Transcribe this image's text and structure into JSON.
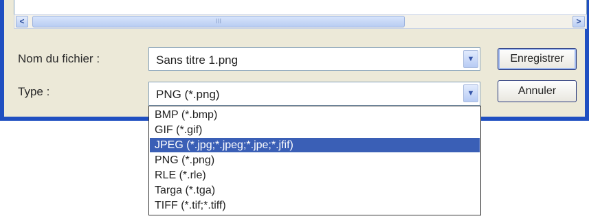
{
  "file_pane": {
    "scroll_thumb_grip": "III",
    "scroll_left_glyph": "<",
    "scroll_right_glyph": ">"
  },
  "form": {
    "filename_label": "Nom du fichier :",
    "filename_value": "Sans titre 1.png",
    "type_label": "Type :",
    "type_value": "PNG (*.png)",
    "dropdown_glyph": "▼"
  },
  "buttons": {
    "save": "Enregistrer",
    "cancel": "Annuler"
  },
  "type_options": [
    {
      "label": "BMP (*.bmp)",
      "selected": false
    },
    {
      "label": "GIF (*.gif)",
      "selected": false
    },
    {
      "label": "JPEG (*.jpg;*.jpeg;*.jpe;*.jfif)",
      "selected": true
    },
    {
      "label": "PNG (*.png)",
      "selected": false
    },
    {
      "label": "RLE (*.rle)",
      "selected": false
    },
    {
      "label": "Targa (*.tga)",
      "selected": false
    },
    {
      "label": "TIFF (*.tif;*.tiff)",
      "selected": false
    }
  ],
  "colors": {
    "window_frame": "#1f4fc1",
    "dialog_bg": "#ece9d8",
    "selection": "#3a5fb6"
  },
  "icons": [
    "scroll-left-icon",
    "scroll-right-icon",
    "chevron-down-icon"
  ]
}
